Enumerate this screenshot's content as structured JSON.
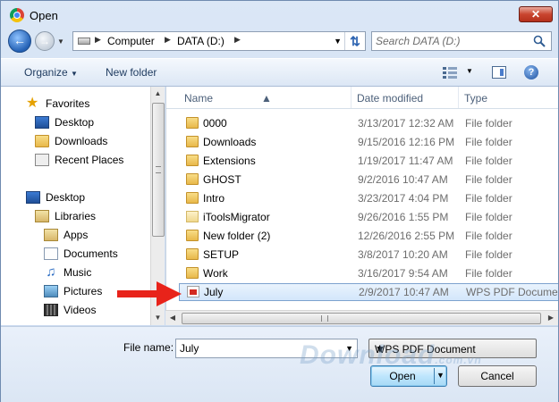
{
  "window": {
    "title": "Open",
    "close_glyph": "✕"
  },
  "address": {
    "crumbs": [
      "Computer",
      "DATA (D:)"
    ]
  },
  "search": {
    "placeholder": "Search DATA (D:)"
  },
  "toolbar": {
    "organize": "Organize",
    "new_folder": "New folder",
    "help": "?"
  },
  "nav": {
    "favorites": {
      "label": "Favorites",
      "icon": "star-icon"
    },
    "favorites_items": [
      {
        "label": "Desktop",
        "icon": "desktop-icon"
      },
      {
        "label": "Downloads",
        "icon": "folder-icon"
      },
      {
        "label": "Recent Places",
        "icon": "recent-places-icon"
      }
    ],
    "desktop": {
      "label": "Desktop",
      "icon": "desktop-icon"
    },
    "libraries": {
      "label": "Libraries",
      "icon": "libraries-icon"
    },
    "library_items": [
      {
        "label": "Apps",
        "icon": "apps-icon"
      },
      {
        "label": "Documents",
        "icon": "documents-icon"
      },
      {
        "label": "Music",
        "icon": "music-icon"
      },
      {
        "label": "Pictures",
        "icon": "pictures-icon"
      },
      {
        "label": "Videos",
        "icon": "videos-icon"
      }
    ]
  },
  "columns": {
    "name": "Name",
    "date": "Date modified",
    "type": "Type"
  },
  "files": [
    {
      "name": "0000",
      "date": "3/13/2017 12:32 AM",
      "type": "File folder",
      "icon": "folder-icon"
    },
    {
      "name": "Downloads",
      "date": "9/15/2016 12:16 PM",
      "type": "File folder",
      "icon": "folder-icon"
    },
    {
      "name": "Extensions",
      "date": "1/19/2017 11:47 AM",
      "type": "File folder",
      "icon": "folder-icon"
    },
    {
      "name": "GHOST",
      "date": "9/2/2016 10:47 AM",
      "type": "File folder",
      "icon": "folder-icon"
    },
    {
      "name": "Intro",
      "date": "3/23/2017 4:04 PM",
      "type": "File folder",
      "icon": "folder-icon"
    },
    {
      "name": "iToolsMigrator",
      "date": "9/26/2016 1:55 PM",
      "type": "File folder",
      "icon": "folder-light-icon"
    },
    {
      "name": "New folder (2)",
      "date": "12/26/2016 2:55 PM",
      "type": "File folder",
      "icon": "folder-icon"
    },
    {
      "name": "SETUP",
      "date": "3/8/2017 10:20 AM",
      "type": "File folder",
      "icon": "folder-icon"
    },
    {
      "name": "Work",
      "date": "3/16/2017 9:54 AM",
      "type": "File folder",
      "icon": "folder-icon"
    },
    {
      "name": "July",
      "date": "2/9/2017 10:47 AM",
      "type": "WPS PDF Docume...",
      "icon": "pdf-file-icon",
      "selected": true
    }
  ],
  "footer": {
    "file_name_label": "File name:",
    "file_name_value": "July",
    "file_type": "WPS PDF Document",
    "open": "Open",
    "cancel": "Cancel"
  },
  "watermark": {
    "text": "Download",
    "suffix": ".com.vn"
  },
  "colors": {
    "accent": "#3c7fb1",
    "arrow": "#e8231a",
    "selection": "#d3e6fb"
  }
}
